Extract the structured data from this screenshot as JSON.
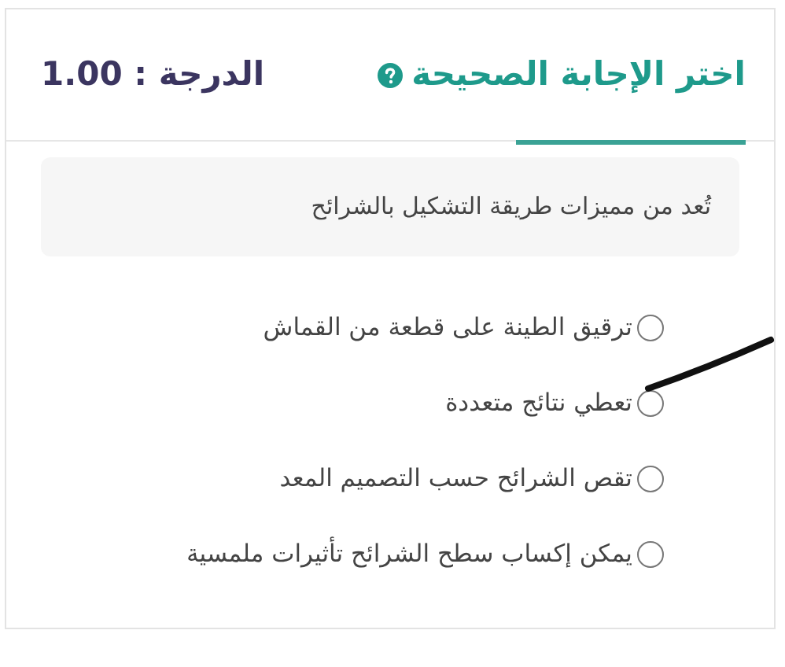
{
  "header": {
    "title": "اختر الإجابة الصحيحة",
    "grade": "الدرجة : 1.00"
  },
  "question": "تُعد من مميزات طريقة التشكيل بالشرائح",
  "options": [
    {
      "label": "ترقيق الطينة على قطعة من القماش",
      "selected": false
    },
    {
      "label": "تعطي نتائج متعددة",
      "selected": false
    },
    {
      "label": "تقص الشرائح حسب التصميم المعد",
      "selected": false
    },
    {
      "label": "يمكن إكساب سطح الشرائح تأثيرات ملمسية",
      "selected": false
    }
  ]
}
